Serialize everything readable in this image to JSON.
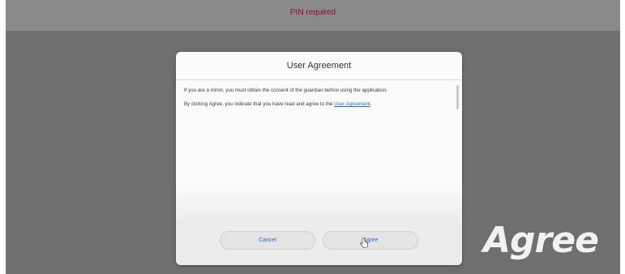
{
  "topbar": {
    "title": "PIN required"
  },
  "dialog": {
    "title": "User Agreement",
    "body": {
      "line1": "If you are a minor, you must obtain the consent of the guardian before using the application.",
      "line2_prefix": "By clicking Agree, you indicate that you have read and agree to the ",
      "line2_link": "User Agreement",
      "line2_suffix": "."
    },
    "buttons": {
      "cancel_label": "Cancel",
      "agree_label": "Agree"
    }
  },
  "overlay": {
    "watermark_text": "Agree"
  },
  "colors": {
    "accent_link": "#2a6fd0",
    "button_text": "#2f66c6",
    "topbar_title": "#9a0a2a"
  },
  "icons": {
    "cursor": "hand-pointer-cursor-icon"
  }
}
